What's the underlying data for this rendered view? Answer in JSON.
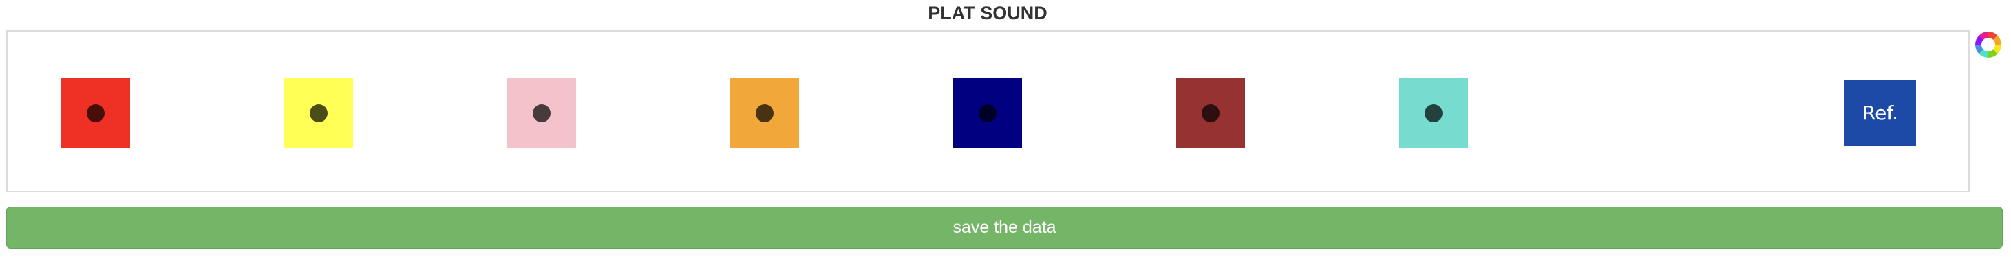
{
  "page": {
    "title": "PLAT SOUND"
  },
  "swatches": [
    {
      "name": "red",
      "color": "#ee3124"
    },
    {
      "name": "yellow",
      "color": "#ffff55"
    },
    {
      "name": "pink",
      "color": "#f4c2cb"
    },
    {
      "name": "orange",
      "color": "#f2a73b"
    },
    {
      "name": "navy",
      "color": "#000080"
    },
    {
      "name": "brown",
      "color": "#963232"
    },
    {
      "name": "turquoise",
      "color": "#76dccf"
    }
  ],
  "ref_button": {
    "label": "Ref.",
    "color": "#1c4aa6"
  },
  "palette_icon": {
    "name": "color-wheel-icon"
  },
  "save_button": {
    "label": "save the data",
    "color": "#74b567"
  }
}
